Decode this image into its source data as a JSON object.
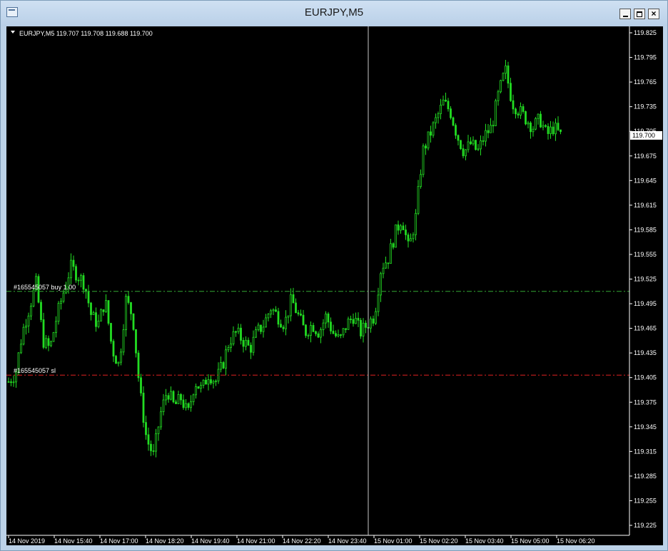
{
  "window": {
    "title": "EURJPY,M5"
  },
  "chart_data": {
    "type": "candlestick",
    "symbol_line": "EURJPY,M5  119.707 119.708 119.688 119.700",
    "current_price": "119.700",
    "y_ticks": [
      "119.825",
      "119.795",
      "119.765",
      "119.735",
      "119.705",
      "119.675",
      "119.645",
      "119.615",
      "119.585",
      "119.555",
      "119.525",
      "119.495",
      "119.465",
      "119.435",
      "119.405",
      "119.375",
      "119.345",
      "119.315",
      "119.285",
      "119.255",
      "119.225"
    ],
    "ylim": [
      119.225,
      119.825
    ],
    "x_ticks": [
      "14 Nov 2019",
      "14 Nov 15:40",
      "14 Nov 17:00",
      "14 Nov 18:20",
      "14 Nov 19:40",
      "14 Nov 21:00",
      "14 Nov 22:20",
      "14 Nov 23:40",
      "15 Nov 01:00",
      "15 Nov 02:20",
      "15 Nov 03:40",
      "15 Nov 05:00",
      "15 Nov 06:20"
    ],
    "order_lines": [
      {
        "label": "#165545057 buy 1.00",
        "price": 119.51,
        "color": "#32a832"
      },
      {
        "label": "#165545057 sl",
        "price": 119.408,
        "color": "#e02020"
      }
    ],
    "bull_color": "#22dd22",
    "bear_color": "#22dd22",
    "close_path": [
      119.4,
      119.41,
      119.46,
      119.49,
      119.52,
      119.45,
      119.44,
      119.48,
      119.51,
      119.54,
      119.53,
      119.52,
      119.48,
      119.47,
      119.5,
      119.44,
      119.42,
      119.5,
      119.48,
      119.39,
      119.33,
      119.31,
      119.36,
      119.39,
      119.37,
      119.38,
      119.36,
      119.4,
      119.39,
      119.41,
      119.4,
      119.42,
      119.45,
      119.46,
      119.45,
      119.44,
      119.46,
      119.47,
      119.49,
      119.48,
      119.47,
      119.5,
      119.48,
      119.46,
      119.47,
      119.46,
      119.48,
      119.46,
      119.45,
      119.47,
      119.48,
      119.46,
      119.47,
      119.48,
      119.54,
      119.55,
      119.58,
      119.6,
      119.56,
      119.6,
      119.68,
      119.7,
      119.72,
      119.74,
      119.73,
      119.7,
      119.68,
      119.69,
      119.68,
      119.7,
      119.71,
      119.75,
      119.78,
      119.74,
      119.73,
      119.72,
      119.71,
      119.72,
      119.7,
      119.71,
      119.7
    ]
  }
}
